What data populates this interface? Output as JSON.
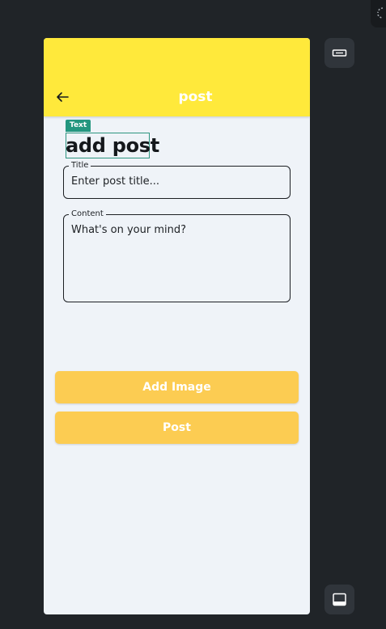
{
  "appbar": {
    "title": "post",
    "back_icon": "arrow-left-icon"
  },
  "inspector": {
    "badge": "Text"
  },
  "page": {
    "heading": "add post"
  },
  "form": {
    "title_field": {
      "label": "Title",
      "placeholder": "Enter post title..."
    },
    "content_field": {
      "label": "Content",
      "placeholder": "What's on your mind?"
    }
  },
  "buttons": {
    "add_image": "Add Image",
    "post": "Post"
  },
  "colors": {
    "appbar": "#ffe93b",
    "button": "#fccc52",
    "inspector": "#23967f",
    "background": "#202428",
    "screen": "#eff3f8"
  },
  "side_tools": {
    "top_icon": "keyboard-icon",
    "bottom_icon": "bottom-panel-icon"
  }
}
